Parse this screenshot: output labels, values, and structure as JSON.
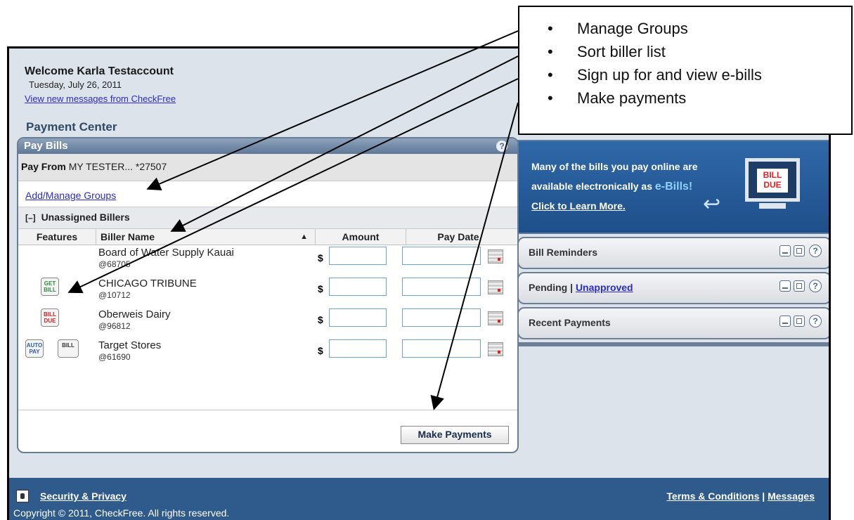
{
  "callout": {
    "items": [
      "Manage Groups",
      "Sort biller list",
      "Sign up for and view e-bills",
      "Make payments"
    ]
  },
  "welcome": {
    "title": "Welcome Karla Testaccount",
    "date": "Tuesday, July 26, 2011",
    "messages_link": "View new messages from CheckFree"
  },
  "payment_center": {
    "title": "Payment Center",
    "panel_title": "Pay Bills",
    "help": "?",
    "pay_from_label": "Pay From",
    "pay_from_value": "MY TESTER... *27507",
    "groups_link": "Add/Manage Groups",
    "unassigned_toggle": "[–]",
    "unassigned_label": "Unassigned Billers",
    "columns": {
      "features": "Features",
      "biller_name": "Biller Name",
      "sort_indicator": "▲",
      "amount": "Amount",
      "pay_date": "Pay Date"
    },
    "billers": [
      {
        "name": "Board of Water Supply Kauai",
        "id": "@68705",
        "features": []
      },
      {
        "name": "CHICAGO TRIBUNE",
        "id": "@10712",
        "features": [
          "GET BILL"
        ]
      },
      {
        "name": "Oberweis Dairy",
        "id": "@96812",
        "features": [
          "BILL DUE"
        ]
      },
      {
        "name": "Target Stores",
        "id": "@61690",
        "features": [
          "AUTO PAY",
          "BILL"
        ]
      }
    ],
    "currency": "$",
    "make_payments": "Make Payments"
  },
  "ebill_banner": {
    "line1": "Many of the bills you pay online are",
    "line2_prefix": "available electronically as ",
    "line2_highlight": "e-Bills!",
    "line3": "Click to Learn More.",
    "monitor_text": "BILL DUE"
  },
  "widgets": {
    "bill_reminders": "Bill Reminders",
    "pending": "Pending",
    "separator": " | ",
    "unapproved": "Unapproved",
    "recent_payments": "Recent Payments",
    "help": "?"
  },
  "footer": {
    "security": "Security & Privacy",
    "copyright": "Copyright © 2011, CheckFree. All rights reserved.",
    "terms": "Terms & Conditions",
    "separator": " | ",
    "messages": "Messages"
  },
  "colors": {
    "footer_bg": "#2e5a8c",
    "panel_header": "#6f87a6",
    "link": "#2b2bc8",
    "ebill_bg": "#2a5f9e"
  }
}
